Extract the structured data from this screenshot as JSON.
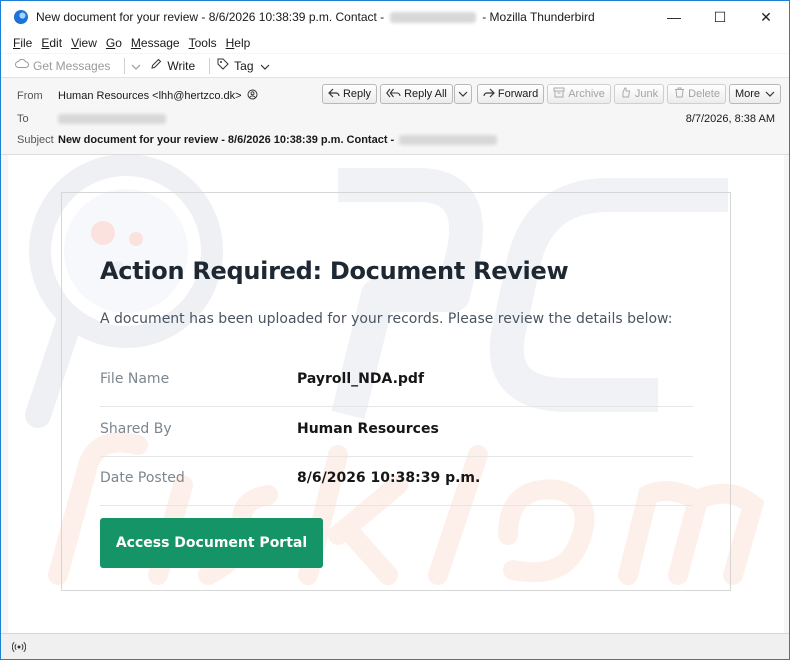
{
  "window": {
    "title_prefix": "New document for your review - 8/6/2026 10:38:39 p.m. Contact -",
    "title_suffix": "- Mozilla Thunderbird",
    "controls": {
      "minimize": "—",
      "maximize": "☐",
      "close": "✕"
    }
  },
  "menu": {
    "items": [
      {
        "u": "F",
        "rest": "ile"
      },
      {
        "u": "E",
        "rest": "dit"
      },
      {
        "u": "V",
        "rest": "iew"
      },
      {
        "u": "G",
        "rest": "o"
      },
      {
        "u": "M",
        "rest": "essage"
      },
      {
        "u": "T",
        "rest": "ools"
      },
      {
        "u": "H",
        "rest": "elp"
      }
    ]
  },
  "toolbar": {
    "get_messages": "Get Messages",
    "write": "Write",
    "tag": "Tag"
  },
  "header": {
    "from_label": "From",
    "from_value": "Human Resources <lhh@hertzco.dk>",
    "to_label": "To",
    "subject_label": "Subject",
    "subject_value": "New document for your review - 8/6/2026 10:38:39 p.m. Contact -",
    "date": "8/7/2026, 8:38 AM",
    "buttons": {
      "reply": "Reply",
      "reply_all": "Reply All",
      "forward": "Forward",
      "archive": "Archive",
      "junk": "Junk",
      "delete": "Delete",
      "more": "More"
    }
  },
  "email": {
    "title": "Action Required: Document Review",
    "intro": "A document has been uploaded for your records. Please review the details below:",
    "details": [
      {
        "label": "File Name",
        "value": "Payroll_NDA.pdf"
      },
      {
        "label": "Shared By",
        "value": "Human Resources"
      },
      {
        "label": "Date Posted",
        "value": "8/6/2026 10:38:39 p.m."
      }
    ],
    "cta": "Access Document Portal"
  },
  "icons": {
    "app": "thunderbird-icon",
    "get_messages": "cloud-download-icon",
    "write": "pencil-icon",
    "tag": "tag-icon",
    "reply": "reply-icon",
    "reply_all": "reply-all-icon",
    "forward": "forward-icon",
    "archive": "archive-icon",
    "junk": "junk-icon",
    "delete": "trash-icon",
    "status": "wifi-signal-icon"
  },
  "colors": {
    "cta_green": "#159467",
    "window_border": "#1e7fd6"
  }
}
